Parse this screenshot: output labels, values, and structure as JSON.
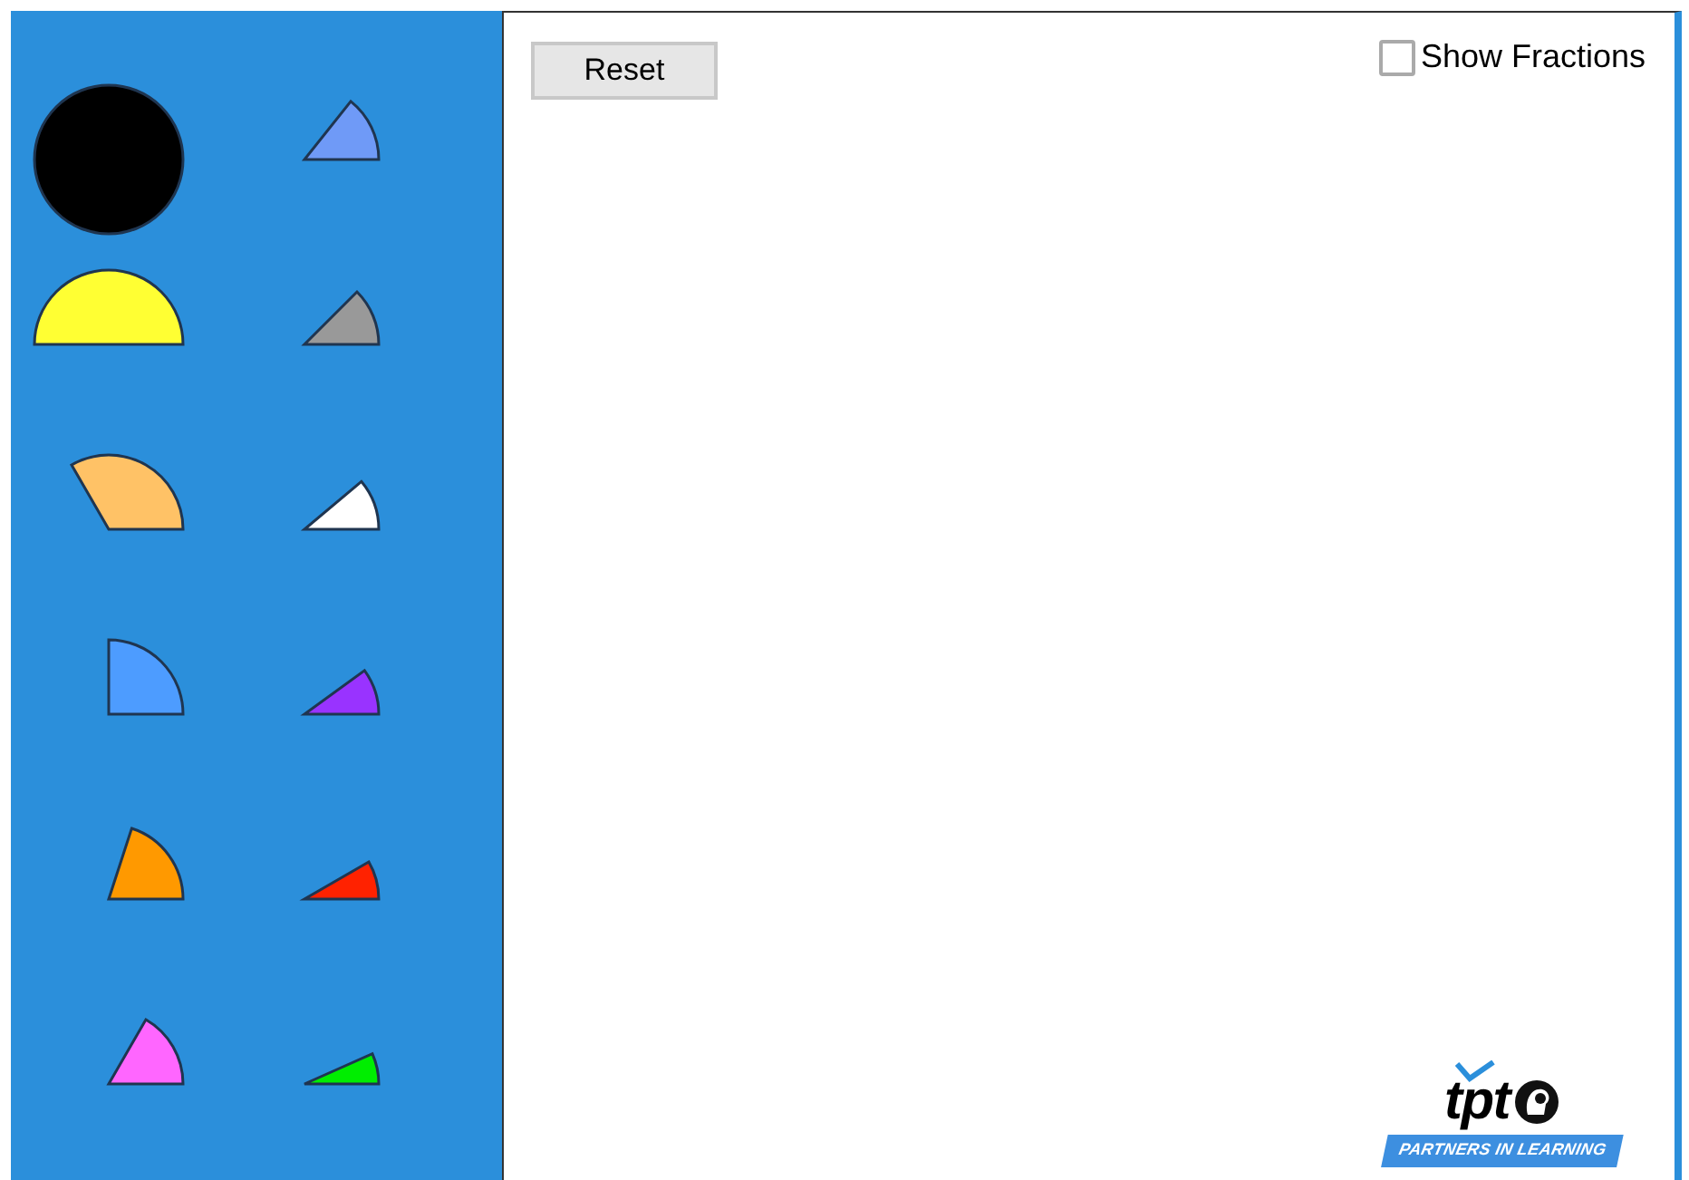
{
  "pieces": [
    {
      "kind": "whole",
      "color": "#000000"
    },
    {
      "kind": "seventh",
      "color": "#6f9af7"
    },
    {
      "kind": "half",
      "color": "#ffff33"
    },
    {
      "kind": "eighth",
      "color": "#999999"
    },
    {
      "kind": "third",
      "color": "#ffc266"
    },
    {
      "kind": "ninth",
      "color": "#ffffff"
    },
    {
      "kind": "quarter",
      "color": "#4d9cff"
    },
    {
      "kind": "tenth",
      "color": "#9933ff"
    },
    {
      "kind": "fifth",
      "color": "#ff9900"
    },
    {
      "kind": "twelfth",
      "color": "#ff2200"
    },
    {
      "kind": "sixth",
      "color": "#ff66ff"
    },
    {
      "kind": "fifteenth",
      "color": "#00ee00"
    }
  ],
  "reset_button": "Reset",
  "show_fractions": {
    "label": "Show Fractions",
    "checked": false
  },
  "logo": {
    "wordmark": "tpt",
    "tagline": "PARTNERS IN LEARNING"
  }
}
